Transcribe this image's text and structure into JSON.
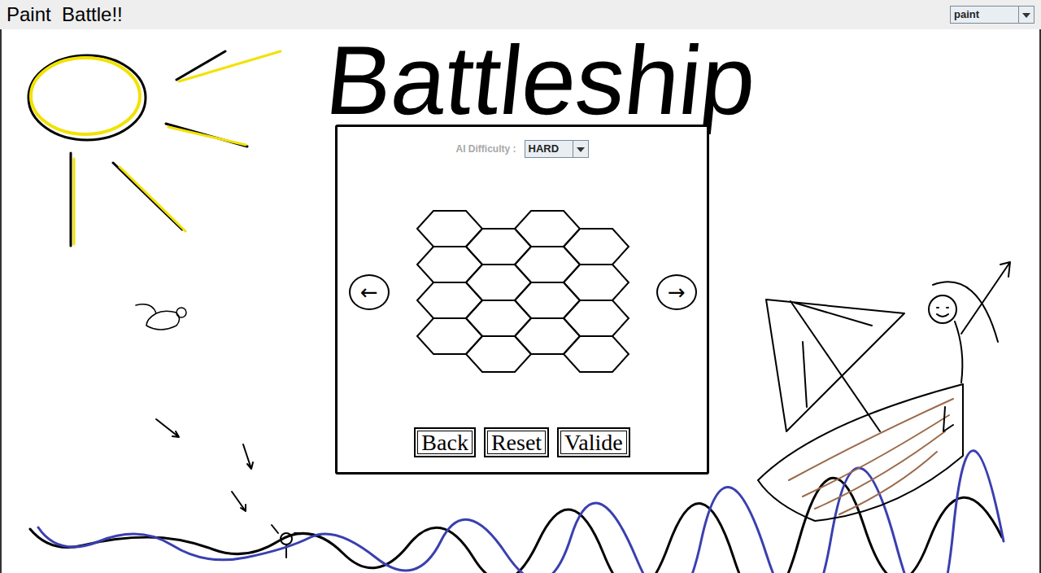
{
  "app": {
    "title": "Paint  Battle!!"
  },
  "mode_dropdown": {
    "value": "paint"
  },
  "banner": {
    "title": "Battleship"
  },
  "dialog": {
    "difficulty": {
      "label": "AI Difficulty :",
      "label_greyed": true,
      "value": "HARD"
    },
    "prev": "←",
    "next": "→",
    "buttons": [
      "Back",
      "Reset",
      "Valide"
    ]
  }
}
